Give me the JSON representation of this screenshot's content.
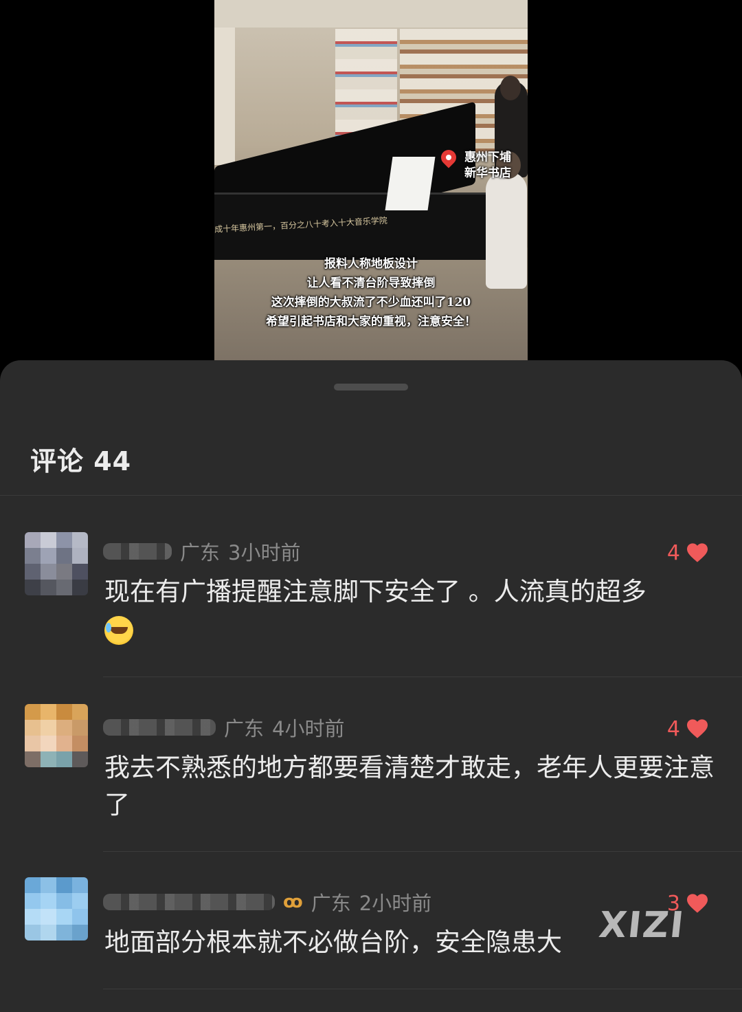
{
  "video": {
    "piano_text": "成十年惠州第一，百分之八十考入十大音乐学院",
    "location_text": "惠州下埔\n新华书店",
    "caption_lines": [
      "报料人称地板设计",
      "让人看不清台阶导致摔倒",
      "这次摔倒的大叔流了不少血还叫了120",
      "希望引起书店和大家的重视，注意安全！"
    ]
  },
  "comments": {
    "title": "评论 44",
    "items": [
      {
        "region": "广东",
        "time": "3小时前",
        "likes": "4",
        "text": "现在有广播提醒注意脚下安全了 。人流真的超多",
        "has_emoji": true,
        "emoji": "laughing-crying-emoji"
      },
      {
        "region": "广东",
        "time": "4小时前",
        "likes": "4",
        "text": "我去不熟悉的地方都要看清楚才敢走，老年人更要注意了"
      },
      {
        "region": "广东",
        "time": "2小时前",
        "likes": "3",
        "text": "地面部分根本就不必做台阶，安全隐患大",
        "vip_icon": "vip-badge-icon"
      }
    ]
  },
  "watermark": "XIZI",
  "colors": {
    "sheet_bg": "#2b2b2b",
    "like_red": "#f05a5a",
    "meta_gray": "#8a8a8a",
    "text": "#ececec"
  }
}
